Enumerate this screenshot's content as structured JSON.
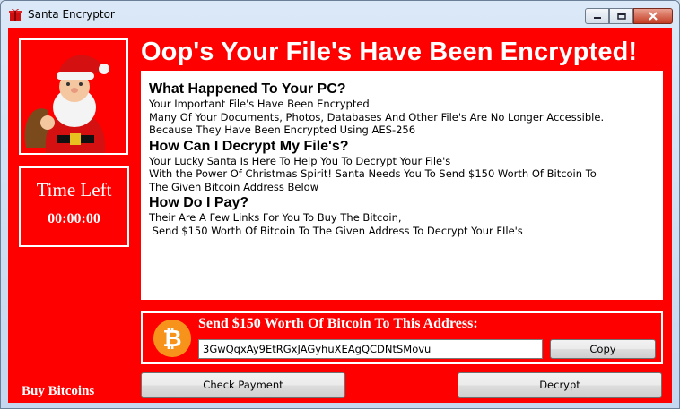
{
  "window": {
    "title": "Santa Encryptor"
  },
  "headline": "Oop's Your File's Have Been Encrypted!",
  "timer": {
    "label": "Time Left",
    "value": "00:00:00"
  },
  "info": {
    "sections": [
      {
        "heading": "What Happened To Your PC?",
        "lines": [
          "Your Important File's Have Been Encrypted",
          "Many Of Your Documents, Photos, Databases And Other File's Are No Longer Accessible.",
          "Because They Have Been Encrypted Using AES-256"
        ]
      },
      {
        "heading": "How Can I Decrypt My File's?",
        "lines": [
          "Your Lucky Santa Is Here To Help You To Decrypt Your File's",
          "With the Power Of Christmas Spirit! Santa Needs You To Send $150 Worth Of Bitcoin To",
          "The Given Bitcoin Address Below"
        ]
      },
      {
        "heading": "How Do I Pay?",
        "lines": [
          "Their Are A Few Links For You To Buy The Bitcoin,",
          " Send $150 Worth Of Bitcoin To The Given Address To Decrypt Your FIle's"
        ]
      }
    ]
  },
  "payment": {
    "title": "Send $150 Worth Of Bitcoin To This Address:",
    "address": "3GwQqxAy9EtRGxJAGyhuXEAgQCDNtSMovu",
    "copy_label": "Copy"
  },
  "buttons": {
    "check_payment": "Check Payment",
    "decrypt": "Decrypt"
  },
  "buy_link": "Buy Bitcoins",
  "colors": {
    "background": "#ff0000",
    "text": "#ffffff",
    "bitcoin": "#f7931a"
  }
}
